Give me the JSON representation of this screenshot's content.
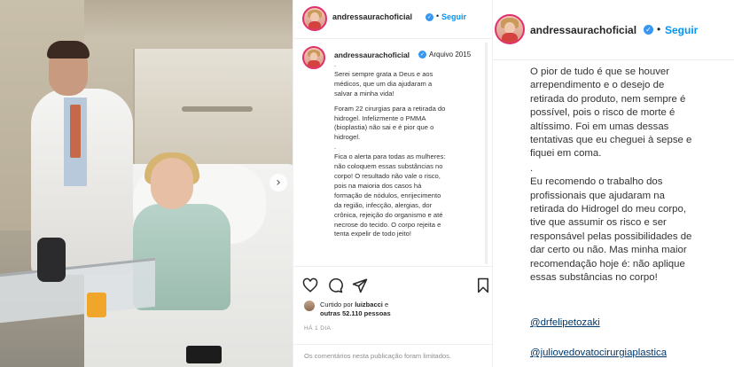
{
  "photo": {
    "next_icon": "chevron-right-icon"
  },
  "post": {
    "header": {
      "username": "andressaurachoficial",
      "verified_icon": "verified-badge-icon",
      "dot": "•",
      "follow_label": "Seguir"
    },
    "caption": {
      "username": "andressaurachoficial",
      "archive_label": "Arquivo 2015",
      "lines": [
        ".",
        "Serei sempre grata a Deus e aos",
        "médicos, que um dia ajudaram a",
        "salvar a minha vida!",
        ".",
        "Foram 22 cirurgias para a retirada do",
        "hidrogel. Infelizmente o PMMA",
        "(bioplastia) não sai e é pior que o",
        "hidrogel.",
        ".",
        "Fica o alerta para todas as mulheres:",
        "não coloquem essas substâncias no",
        "corpo! O resultado não vale o risco,",
        "pois na maioria dos casos há",
        "formação de nódulos, enrijecimento",
        "da região, infecção, alergias, dor",
        "crônica, rejeição do organismo e até",
        "necrose do tecido. O corpo rejeita e",
        "tenta expelir de todo jeito!"
      ]
    },
    "actions": {
      "like_icon": "heart-icon",
      "comment_icon": "comment-icon",
      "share_icon": "send-icon",
      "save_icon": "bookmark-icon"
    },
    "likes": {
      "prefix": "Curtido por ",
      "user": "luizbacci",
      "conj": " e",
      "others": "outras 52.110 pessoas"
    },
    "time": "HÁ 1 DIA",
    "comments_disabled": "Os comentários nesta publicação foram limitados."
  },
  "zoom": {
    "header": {
      "username": "andressaurachoficial",
      "verified": "✓",
      "dot": "•",
      "follow_label": "Seguir"
    },
    "paragraph1": [
      "O pior de tudo é que se houver",
      "arrependimento e o desejo de",
      "retirada do produto, nem sempre é",
      "possível, pois o risco de morte é",
      "altíssimo. Foi em umas dessas",
      "tentativas que eu cheguei à sepse e",
      "fiquei em coma."
    ],
    "paragraph2_dot": ".",
    "paragraph2": [
      "Eu recomendo o trabalho dos",
      "profissionais que ajudaram na",
      "retirada do Hidrogel do meu corpo,",
      "tive que assumir os risco e ser",
      "responsável pelas possibilidades de",
      "dar certo ou não. Mas minha maior",
      "recomendação hoje é: não aplique",
      "essas substâncias no corpo!"
    ],
    "handle1": "@drfelipetozaki",
    "handle2": "@juliovedovatocirurgiaplastica"
  }
}
